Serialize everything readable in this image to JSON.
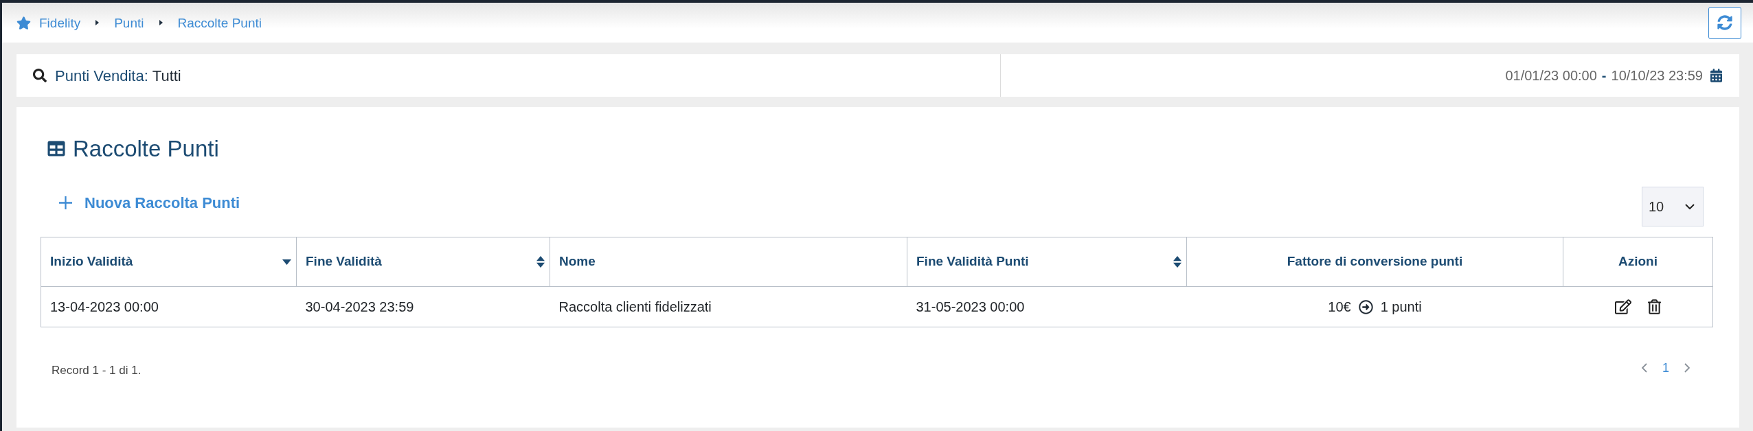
{
  "breadcrumb": [
    {
      "label": "Fidelity"
    },
    {
      "label": "Punti"
    },
    {
      "label": "Raccolte Punti"
    }
  ],
  "filter_bar": {
    "store_filter": {
      "label": "Punti Vendita:",
      "value": "Tutti"
    },
    "date_range": {
      "from": "01/01/23 00:00",
      "separator": "-",
      "to": "10/10/23 23:59"
    }
  },
  "panel": {
    "title": "Raccolte Punti",
    "new_button": "Nuova Raccolta Punti",
    "page_size": "10"
  },
  "table": {
    "columns": [
      {
        "label": "Inizio Validità",
        "sortable": true,
        "sorted": true
      },
      {
        "label": "Fine Validità",
        "sortable": true,
        "sorted": false
      },
      {
        "label": "Nome",
        "sortable": false
      },
      {
        "label": "Fine Validità Punti",
        "sortable": true,
        "sorted": false
      },
      {
        "label": "Fattore di conversione punti",
        "sortable": false
      },
      {
        "label": "Azioni",
        "sortable": false
      }
    ],
    "rows": [
      {
        "cells": [
          "13-04-2023 00:00",
          "30-04-2023 23:59",
          "Raccolta clienti fidelizzati",
          "31-05-2023 00:00"
        ],
        "conversion": {
          "from": "10€",
          "to": "1 punti"
        }
      }
    ]
  },
  "footer": {
    "record_info": "Record 1 - 1 di 1.",
    "pages": [
      {
        "label": "1",
        "selected": true
      }
    ]
  }
}
